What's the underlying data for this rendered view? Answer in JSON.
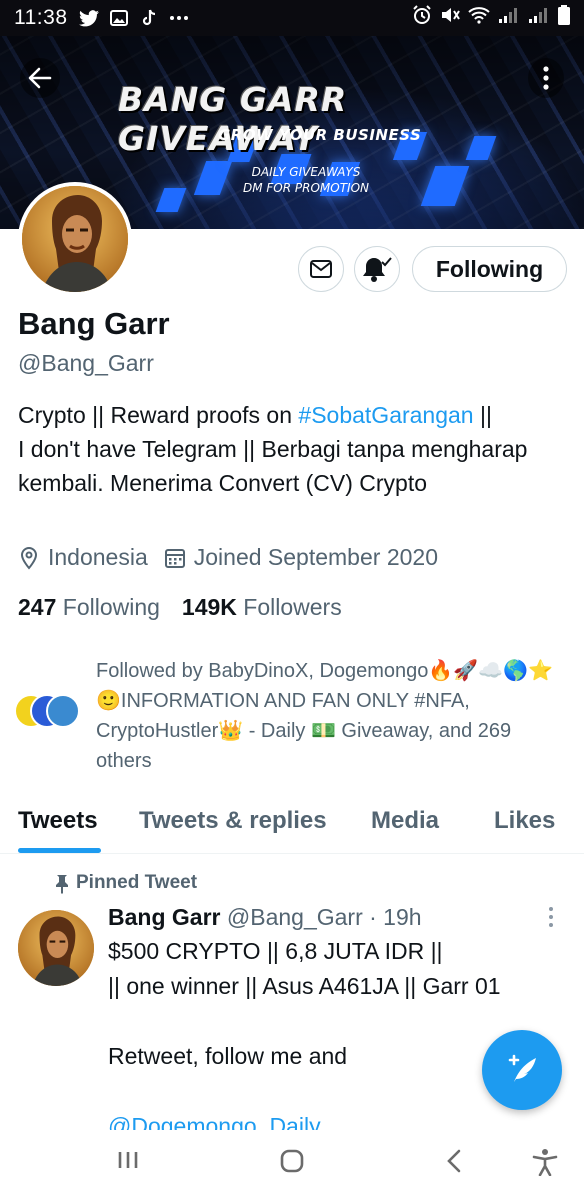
{
  "status_bar": {
    "time": "11:38"
  },
  "banner": {
    "title": "BANG GARR GIVEAWAY",
    "subtitle": "GROW YOUR BUSINESS",
    "line1": "DAILY GIVEAWAYS",
    "line2": "DM FOR PROMOTION"
  },
  "actions": {
    "follow_label": "Following"
  },
  "profile": {
    "name": "Bang Garr",
    "handle": "@Bang_Garr",
    "bio_pre": "Crypto || Reward proofs on ",
    "bio_hashtag": "#SobatGarangan",
    "bio_post": " ||           I don't have Telegram || Berbagi tanpa mengharap kembali. Menerima Convert (CV) Crypto",
    "location": "Indonesia",
    "joined": "Joined September 2020",
    "following_count": "247",
    "following_label": "Following",
    "followers_count": "149K",
    "followers_label": "Followers",
    "followed_by": "Followed by BabyDinoX, Dogemongo🔥🚀☁️🌎⭐🙂INFORMATION AND FAN ONLY #NFA, CryptoHustler👑 - Daily 💵 Giveaway, and 269 others"
  },
  "tabs": [
    {
      "label": "Tweets"
    },
    {
      "label": "Tweets & replies"
    },
    {
      "label": "Media"
    },
    {
      "label": "Likes"
    }
  ],
  "tweet": {
    "pinned_label": "Pinned Tweet",
    "author": "Bang Garr",
    "handle_time": "@Bang_Garr · 19h",
    "body": "$500 CRYPTO || 6,8 JUTA IDR ||\n|| one winner || Asus A461JA || Garr 01\n\nRetweet, follow me and\n\n",
    "mention": "@Dogemongo_Daily"
  },
  "colors": {
    "accent": "#1d9bf0",
    "text": "#0f1419",
    "muted": "#536471"
  }
}
